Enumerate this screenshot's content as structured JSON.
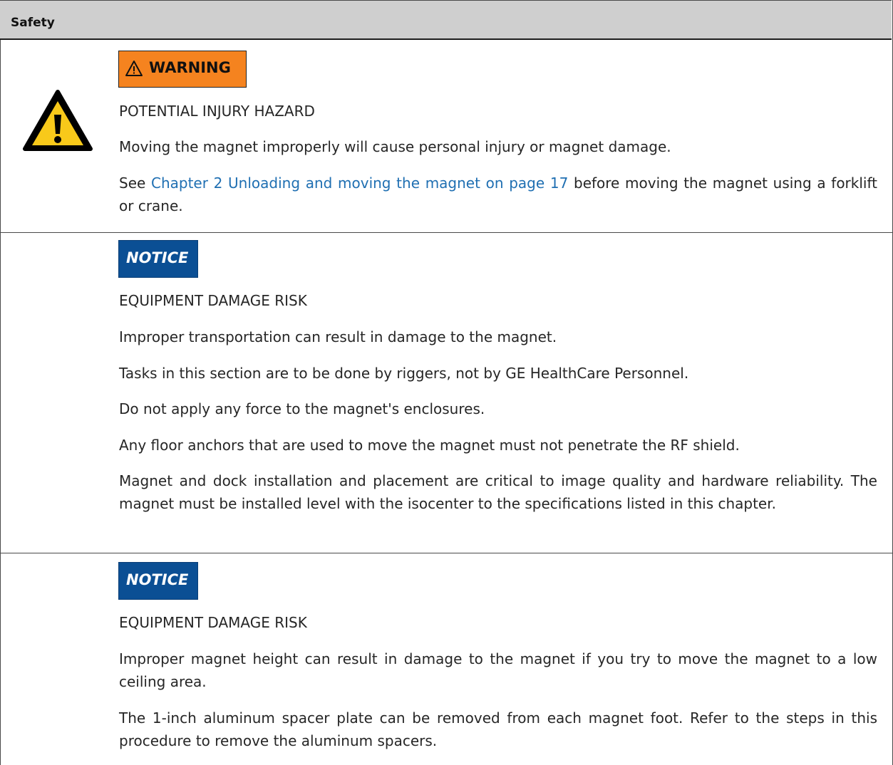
{
  "header": {
    "title": "Safety"
  },
  "warning_block": {
    "badge": "WARNING",
    "hazard": "POTENTIAL INJURY HAZARD",
    "text1": "Moving the magnet improperly will cause personal injury or magnet damage.",
    "text2_prefix": "See ",
    "text2_link": "Chapter 2 Unloading and moving the magnet on page 17",
    "text2_suffix": " before moving the magnet using a forklift or crane."
  },
  "notice_block_1": {
    "badge": "NOTICE",
    "hazard": "EQUIPMENT DAMAGE RISK",
    "p1": "Improper transportation can result in damage to the magnet.",
    "p2": "Tasks in this section are to be done by riggers, not by GE HealthCare Personnel.",
    "p3": "Do not apply any force to the magnet's enclosures.",
    "p4": "Any floor anchors that are used to move the magnet must not penetrate the RF shield.",
    "p5": "Magnet and dock installation and placement are critical to image quality and hardware reliability. The magnet must be installed level with the isocenter to the specifications listed in this chapter."
  },
  "notice_block_2": {
    "badge": "NOTICE",
    "hazard": "EQUIPMENT DAMAGE RISK",
    "p1": "Improper magnet height can result in damage to the magnet if you try to move the magnet to a low ceiling area.",
    "p2": "The 1-inch aluminum spacer plate can be removed from each magnet foot. Refer to the steps in this procedure to remove the aluminum spacers."
  },
  "colors": {
    "warning": "#f5831f",
    "notice": "#0b4f94",
    "link": "#1f6fb2",
    "header_bg": "#cfcfcf"
  },
  "icons": {
    "large": "warning-triangle-icon",
    "small": "warning-triangle-icon"
  }
}
